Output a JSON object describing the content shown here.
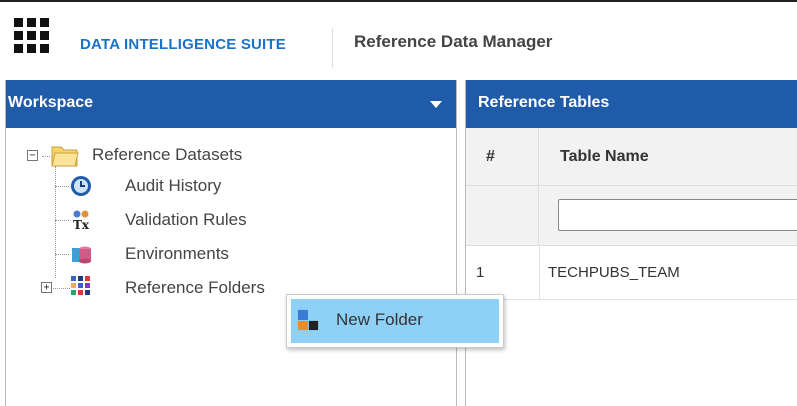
{
  "header": {
    "brand": "DATA INTELLIGENCE SUITE",
    "module_title": "Reference Data Manager",
    "brand_color": "#1a73c8"
  },
  "workspace": {
    "title": "Workspace",
    "header_color": "#1f5ba9",
    "tree": {
      "root": {
        "label": "Reference Datasets",
        "icon": "folder-icon",
        "toggle": "−"
      },
      "children": [
        {
          "label": "Audit History",
          "icon": "clock-icon"
        },
        {
          "label": "Validation Rules",
          "icon": "validation-rules-icon"
        },
        {
          "label": "Environments",
          "icon": "database-icon"
        },
        {
          "label": "Reference Folders",
          "icon": "blocks-icon",
          "toggle": "+"
        }
      ]
    }
  },
  "reference_tables": {
    "title": "Reference Tables",
    "columns": [
      "#",
      "Table Name"
    ],
    "filter_value": "",
    "rows": [
      {
        "num": "1",
        "name": "TECHPUBS_TEAM"
      }
    ]
  },
  "context_menu": {
    "items": [
      {
        "label": "New Folder",
        "icon": "new-folder-icon"
      }
    ],
    "highlight_color": "#8fd0f7"
  }
}
